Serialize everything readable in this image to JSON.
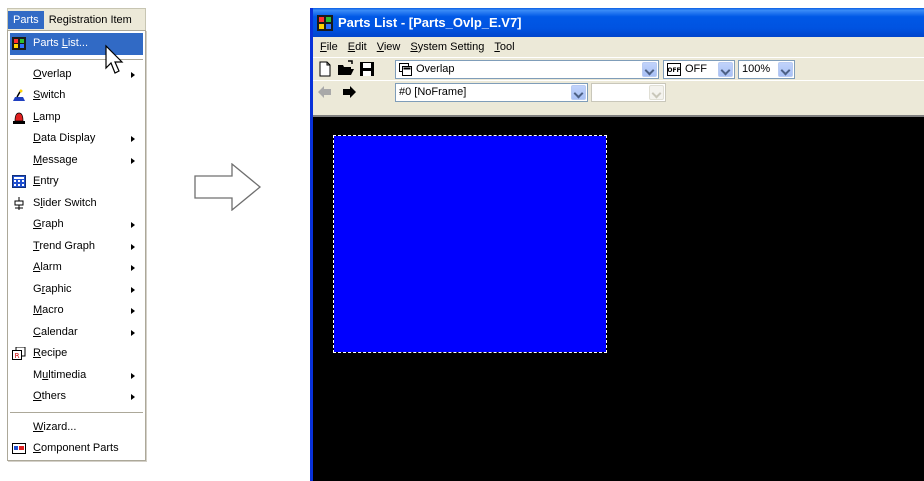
{
  "menubar": {
    "items": [
      "Parts",
      "Registration Item"
    ]
  },
  "menu": {
    "items": [
      {
        "label": "Parts List...",
        "underline": "L",
        "icon": "parts-list-icon",
        "submenu": false,
        "highlighted": true
      },
      {
        "separator": true
      },
      {
        "label": "Overlap",
        "underline": "O",
        "submenu": true
      },
      {
        "label": "Switch",
        "underline": "S",
        "icon": "switch-icon",
        "submenu": false
      },
      {
        "label": "Lamp",
        "underline": "L",
        "icon": "lamp-icon",
        "submenu": false
      },
      {
        "label": "Data Display",
        "underline": "D",
        "submenu": true
      },
      {
        "label": "Message",
        "underline": "M",
        "submenu": true
      },
      {
        "label": "Entry",
        "underline": "E",
        "icon": "entry-icon",
        "submenu": false
      },
      {
        "label": "Slider Switch",
        "underline": "l",
        "icon": "slider-switch-icon",
        "submenu": false
      },
      {
        "label": "Graph",
        "underline": "G",
        "submenu": true
      },
      {
        "label": "Trend Graph",
        "underline": "T",
        "submenu": true
      },
      {
        "label": "Alarm",
        "underline": "A",
        "submenu": true
      },
      {
        "label": "Graphic",
        "underline": "r",
        "submenu": true
      },
      {
        "label": "Macro",
        "underline": "M",
        "submenu": true
      },
      {
        "label": "Calendar",
        "underline": "C",
        "submenu": true
      },
      {
        "label": "Recipe",
        "underline": "R",
        "icon": "recipe-icon",
        "submenu": false
      },
      {
        "label": "Multimedia",
        "underline": "u",
        "submenu": true
      },
      {
        "label": "Others",
        "underline": "O",
        "submenu": true
      },
      {
        "separator": true
      },
      {
        "label": "Wizard...",
        "underline": "W",
        "submenu": false
      },
      {
        "label": "Component Parts",
        "underline": "C",
        "icon": "component-parts-icon",
        "submenu": false
      }
    ]
  },
  "window": {
    "title": "Parts List - [Parts_Ovlp_E.V7]",
    "menu": [
      "File",
      "Edit",
      "View",
      "System Setting",
      "Tool"
    ],
    "overlap_combo": "Overlap",
    "off_combo": "OFF",
    "zoom_combo": "100%",
    "frame_combo": "#0 [NoFrame]",
    "empty_combo": ""
  },
  "colors": {
    "highlight": "#316ac5",
    "titlebar": "#0054e3",
    "canvas": "#000000",
    "part_fill": "#0000ff"
  }
}
